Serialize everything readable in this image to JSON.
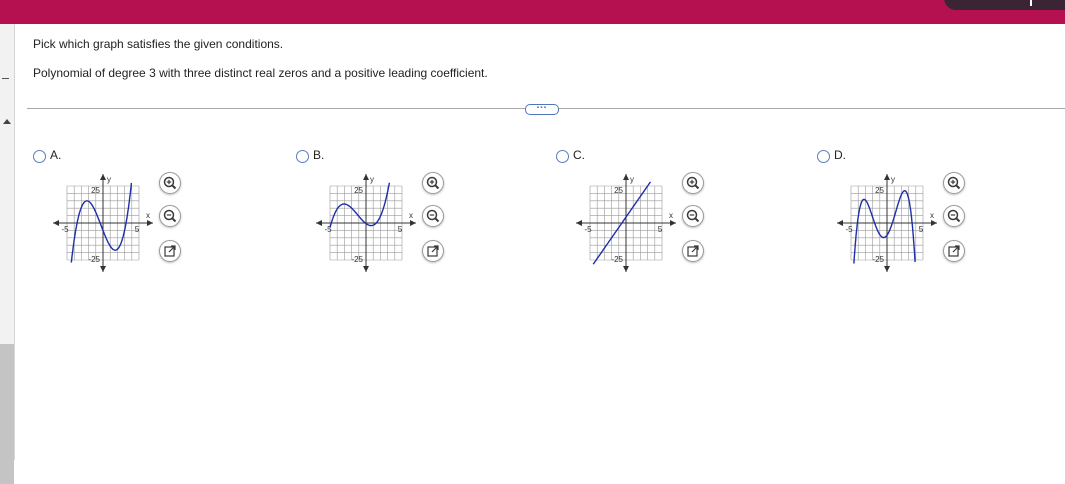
{
  "header": {
    "bar_color": "#b5104f"
  },
  "question": {
    "prompt": "Pick which graph satisfies the given conditions.",
    "condition": "Polynomial of degree 3 with three distinct real zeros and a positive leading coefficient."
  },
  "more_button": {
    "label": "…"
  },
  "options": [
    {
      "label": "A.",
      "curve": "cubic-positive-three-zeros"
    },
    {
      "label": "B.",
      "curve": "cubic-positive-one-zero"
    },
    {
      "label": "C.",
      "curve": "steep-increasing"
    },
    {
      "label": "D.",
      "curve": "quartic-negative"
    }
  ],
  "graph_labels": {
    "y_axis": "y",
    "x_axis": "x",
    "y_max": "25",
    "y_min": "-25",
    "x_min": "-5",
    "x_max": "5"
  },
  "tools": {
    "zoom_in": "zoom-in-icon",
    "zoom_out": "zoom-out-icon",
    "open": "external-link-icon"
  },
  "colors": {
    "curve": "#1f2fa8",
    "accent": "#5b7db8"
  }
}
